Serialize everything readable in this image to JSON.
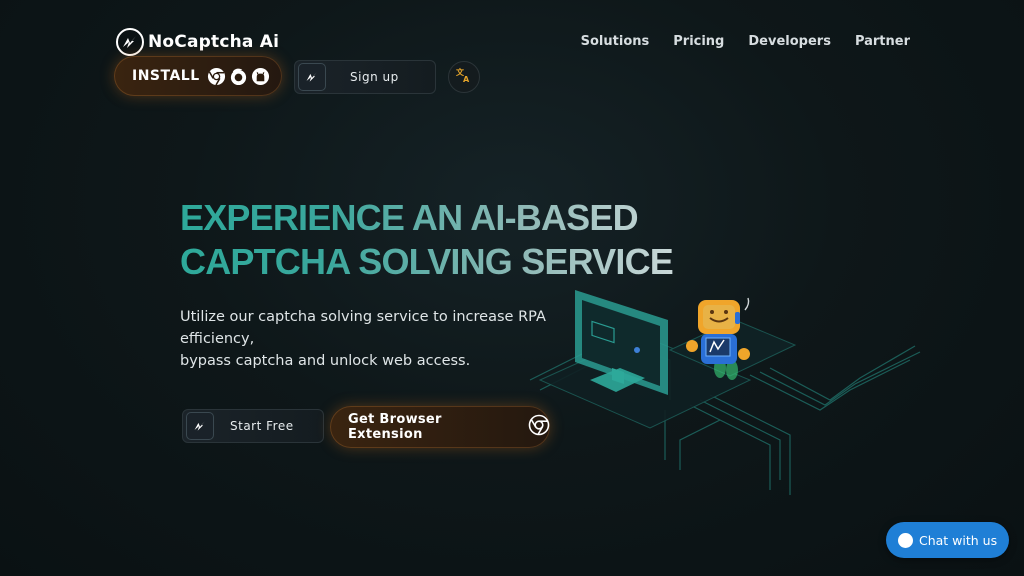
{
  "brand": {
    "name": "NoCaptcha Ai"
  },
  "nav": [
    {
      "label": "Solutions"
    },
    {
      "label": "Pricing"
    },
    {
      "label": "Developers"
    },
    {
      "label": "Partner"
    }
  ],
  "header_buttons": {
    "install_label": "INSTALL",
    "install_icons": [
      "chrome-icon",
      "firefox-icon",
      "github-icon"
    ],
    "signup_label": "Sign up",
    "language_icon": "translate-icon"
  },
  "hero": {
    "title_line1": "EXPERIENCE AN AI-BASED",
    "title_line2": "CAPTCHA SOLVING SERVICE",
    "subtitle_line1": "Utilize our captcha solving service to increase RPA efficiency,",
    "subtitle_line2": "bypass captcha and unlock web access.",
    "start_label": "Start Free",
    "extension_label": "Get Browser Extension"
  },
  "chat": {
    "label": "Chat with us"
  },
  "colors": {
    "accent_teal": "#2ea99a",
    "accent_orange": "#c86e1e",
    "chat_blue": "#1f7fd6",
    "background": "#0e1719"
  }
}
